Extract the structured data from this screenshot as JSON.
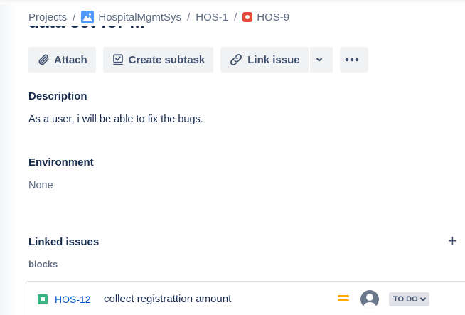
{
  "breadcrumb": {
    "projects": "Projects",
    "project_name": "HospitalMgmtSys",
    "parent_key": "HOS-1",
    "issue_key": "HOS-9",
    "separator": "/"
  },
  "issue_title_partial": "data set for ...",
  "toolbar": {
    "attach_label": "Attach",
    "create_subtask_label": "Create subtask",
    "link_issue_label": "Link issue"
  },
  "description": {
    "title": "Description",
    "text": "As a user, i will be able to fix the bugs."
  },
  "environment": {
    "title": "Environment",
    "text": "None"
  },
  "linked_issues": {
    "title": "Linked issues",
    "relation": "blocks",
    "items": [
      {
        "key": "HOS-12",
        "summary": "collect registrattion amount",
        "status": "TO DO",
        "priority": "medium",
        "type": "story"
      }
    ]
  },
  "colors": {
    "link_blue": "#0052cc",
    "story_green": "#36b37e",
    "bug_red": "#e5493a",
    "priority_medium": "#ffab00",
    "button_bg": "#f1f2f4"
  }
}
